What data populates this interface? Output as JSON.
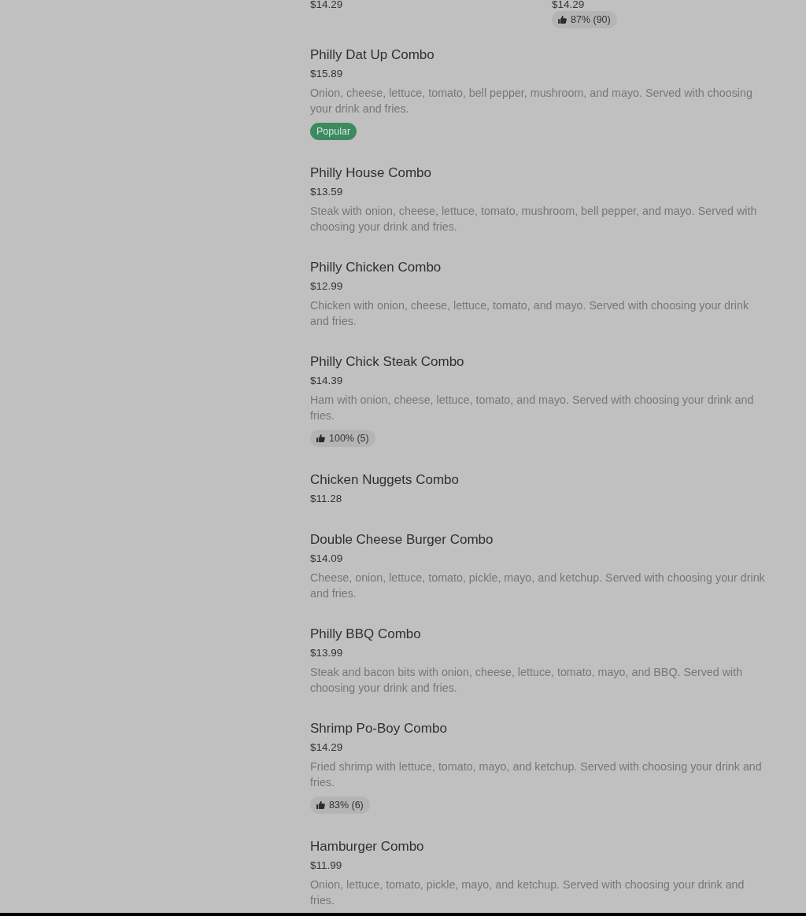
{
  "top_row": [
    {
      "price": "$14.29"
    },
    {
      "price": "$14.29",
      "badge": {
        "kind": "rating",
        "text": "87% (90)"
      }
    }
  ],
  "items": [
    {
      "name": "Philly Dat Up Combo",
      "price": "$15.89",
      "description": "Onion, cheese, lettuce, tomato, bell pepper, mushroom, and mayo. Served with choosing your drink and fries.",
      "badge": {
        "kind": "popular",
        "text": "Popular"
      }
    },
    {
      "name": "Philly House Combo",
      "price": "$13.59",
      "description": "Steak with onion, cheese, lettuce, tomato, mushroom, bell pepper, and mayo. Served with choosing your drink and fries."
    },
    {
      "name": "Philly Chicken Combo",
      "price": "$12.99",
      "description": "Chicken with onion, cheese, lettuce, tomato, and mayo. Served with choosing your drink and fries."
    },
    {
      "name": "Philly Chick Steak Combo",
      "price": "$14.39",
      "description": "Ham with onion, cheese, lettuce, tomato, and mayo. Served with choosing your drink and fries.",
      "badge": {
        "kind": "rating",
        "text": "100% (5)"
      }
    },
    {
      "name": "Chicken Nuggets Combo",
      "price": "$11.28"
    },
    {
      "name": "Double Cheese Burger Combo",
      "price": "$14.09",
      "description": "Cheese, onion, lettuce, tomato, pickle, mayo, and ketchup. Served with choosing your drink and fries."
    },
    {
      "name": "Philly BBQ Combo",
      "price": "$13.99",
      "description": "Steak and bacon bits with onion, cheese, lettuce, tomato, mayo, and BBQ. Served with choosing your drink and fries."
    },
    {
      "name": "Shrimp Po-Boy Combo",
      "price": "$14.29",
      "description": "Fried shrimp with lettuce, tomato, mayo, and ketchup. Served with choosing your drink and fries.",
      "badge": {
        "kind": "rating",
        "text": "83% (6)"
      }
    },
    {
      "name": "Hamburger Combo",
      "price": "$11.99",
      "description": "Onion, lettuce, tomato, pickle, mayo, and ketchup. Served with choosing your drink and fries."
    }
  ]
}
